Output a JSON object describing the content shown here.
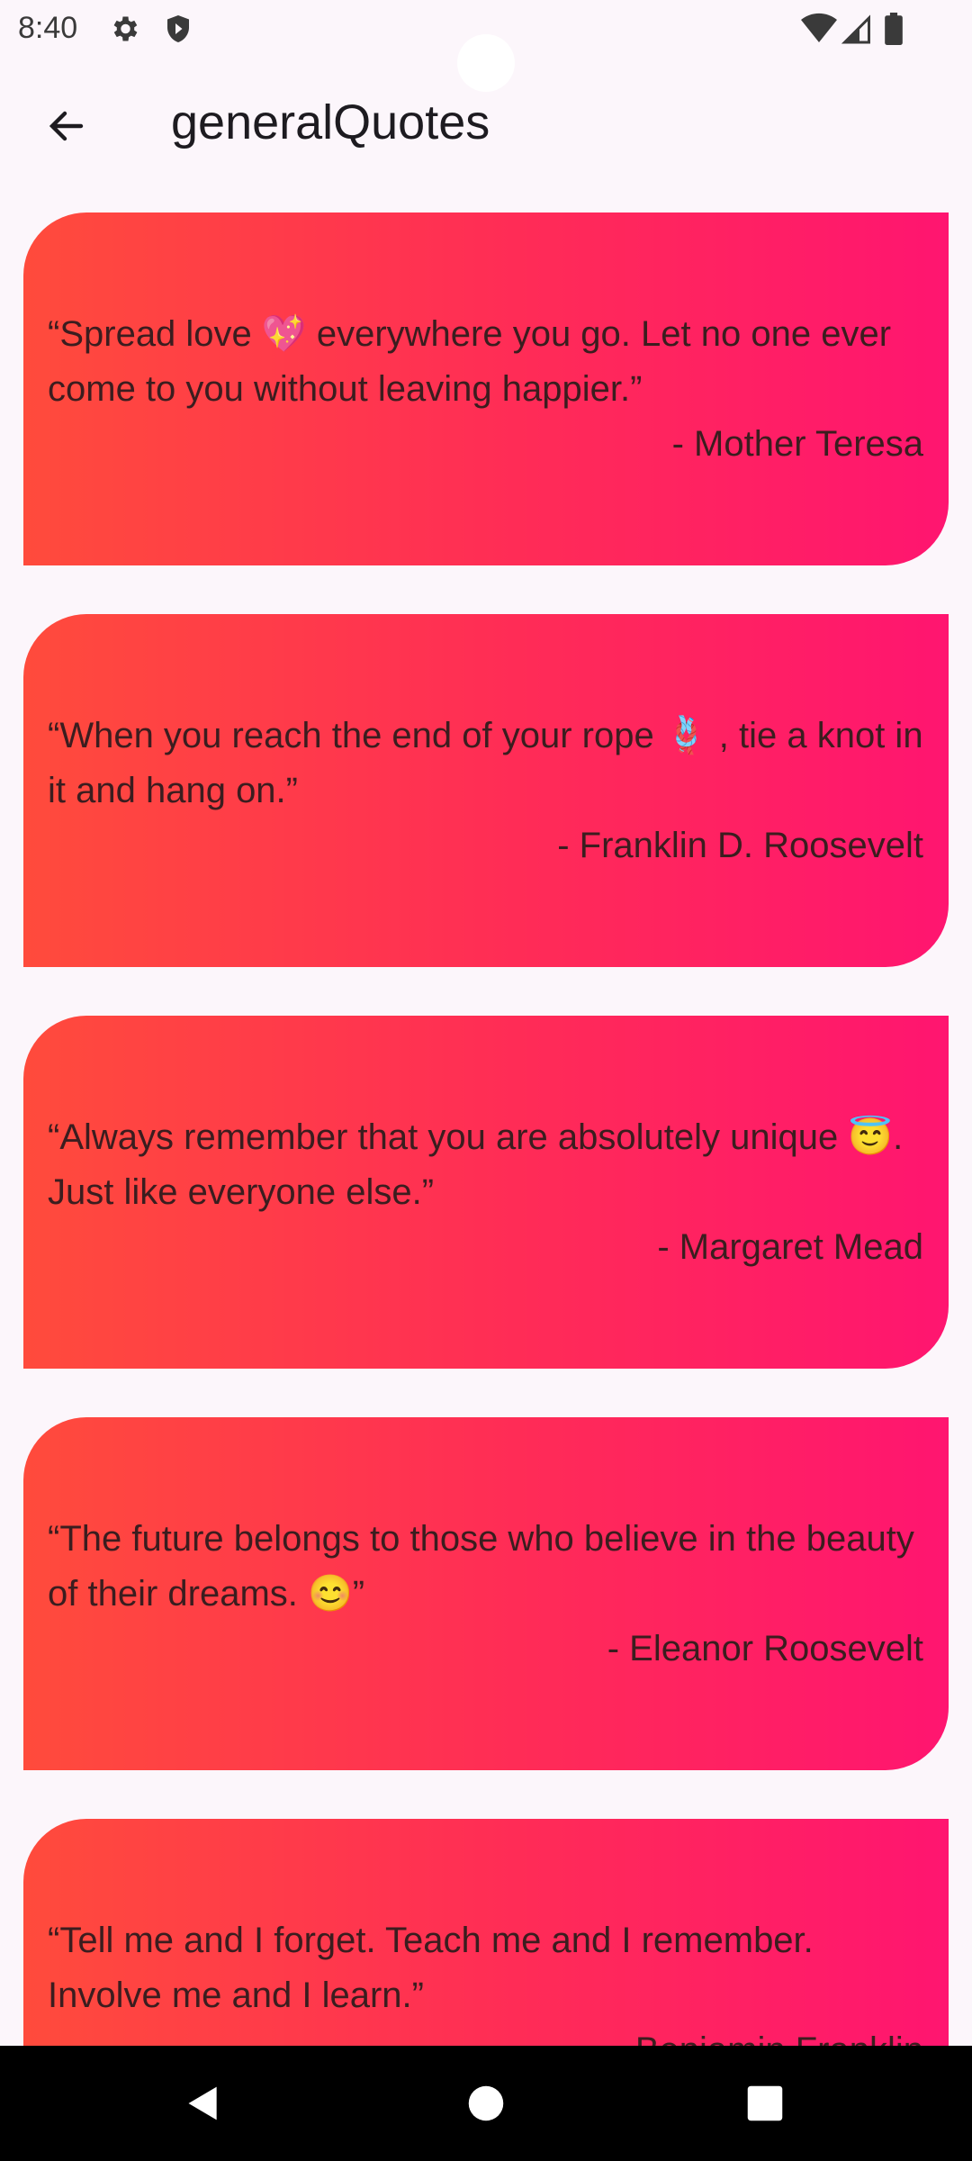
{
  "status_bar": {
    "time": "8:40",
    "icons": [
      "settings-icon",
      "shield-icon",
      "wifi-icon",
      "signal-icon",
      "battery-icon"
    ]
  },
  "app_bar": {
    "title": "generalQuotes",
    "back_icon": "back-arrow-icon"
  },
  "quotes": [
    {
      "text": "“Spread love 💖 everywhere you go. Let no one ever come to you without leaving happier.”",
      "author": "- Mother Teresa"
    },
    {
      "text": "“When you reach the end of your rope 🪢 , tie a knot in it and hang on.”",
      "author": "- Franklin D. Roosevelt"
    },
    {
      "text": "“Always remember that you are absolutely unique 😇. Just like everyone else.”",
      "author": "- Margaret Mead"
    },
    {
      "text": "“The future belongs to those who believe in the beauty of their dreams. 😊”",
      "author": "- Eleanor Roosevelt"
    },
    {
      "text": "“Tell me and I forget. Teach me and I remember. Involve me and I learn.”",
      "author": "- Benjamin Franklin"
    }
  ],
  "nav_bar": {
    "buttons": [
      "back-triangle-icon",
      "home-circle-icon",
      "recents-square-icon"
    ]
  },
  "colors": {
    "background": "#fcf6fb",
    "card_gradient_start": "#ff4b3c",
    "card_gradient_end": "#ff1570",
    "quote_text": "#3b1d1f",
    "nav_bar": "#000000"
  }
}
